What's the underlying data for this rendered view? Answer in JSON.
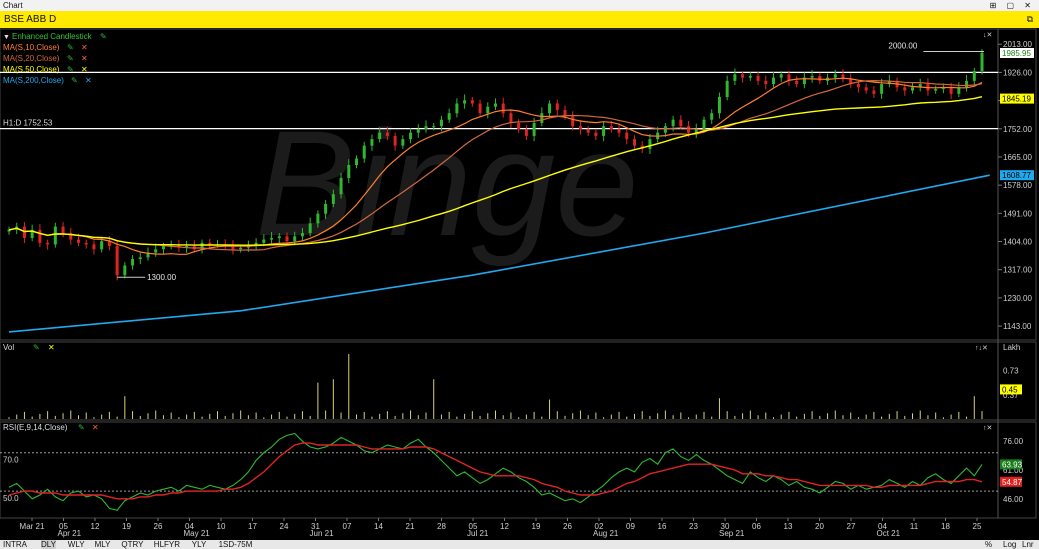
{
  "window": {
    "title": "Chart",
    "controls": "⊞ ▢ ✕"
  },
  "symbol_bar": {
    "symbol": "BSE ABB D",
    "icon": "restore-icon"
  },
  "price_panel": {
    "legend": [
      {
        "label": "Enhanced Candlestick",
        "color": "#34c134"
      },
      {
        "label": "MA(S,10,Close)",
        "color": "#ff7f2a"
      },
      {
        "label": "MA(S,20,Close)",
        "color": "#d2693c"
      },
      {
        "label": "MA(S,50,Close)",
        "color": "#ffff00"
      },
      {
        "label": "MA(S,200,Close)",
        "color": "#1fa9ee"
      }
    ],
    "h1_label": "H1:D 1752.53",
    "annotation_high": "2000.00",
    "annotation_low": "1300.00",
    "y_ticks": [
      "2013.00",
      "1926.00",
      "1839.00",
      "1752.00",
      "1665.00",
      "1578.00",
      "1491.00",
      "1404.00",
      "1317.00",
      "1230.00",
      "1143.00"
    ],
    "badges": [
      {
        "text": "1985.95",
        "value": 1985.95,
        "bg": "#ffffff",
        "fg": "#1a7d1a"
      },
      {
        "text": "1845.19",
        "value": 1845.19,
        "bg": "#ffff00",
        "fg": "#000000"
      },
      {
        "text": "1608.77",
        "value": 1608.77,
        "bg": "#1fa9ee",
        "fg": "#000000"
      }
    ]
  },
  "volume_panel": {
    "label": "Vol",
    "unit": "Lakh",
    "y_ticks": [
      "0.73",
      "0.37"
    ],
    "badge": {
      "text": "0.45",
      "bg": "#ffff00",
      "fg": "#000000"
    }
  },
  "rsi_panel": {
    "label": "RSI(E,9,14,Close)",
    "left_ticks": [
      "70.0",
      "50.0"
    ],
    "y_ticks": [
      "76.00",
      "61.00",
      "46.00"
    ],
    "badges": [
      {
        "text": "63.93",
        "value": 63.93,
        "bg": "#1a7d1a",
        "fg": "#ffffff"
      },
      {
        "text": "54.87",
        "value": 54.87,
        "bg": "#e22020",
        "fg": "#ffffff"
      }
    ]
  },
  "x_axis": {
    "labels": [
      "Mar 21",
      "05",
      "12",
      "19",
      "26",
      "04",
      "10",
      "17",
      "24",
      "31",
      "07",
      "14",
      "21",
      "28",
      "05",
      "12",
      "19",
      "26",
      "02",
      "09",
      "16",
      "23",
      "30",
      "06",
      "13",
      "20",
      "27",
      "04",
      "11",
      "18",
      "25"
    ],
    "month_labels": [
      "Apr 21",
      "May 21",
      "Jun 21",
      "Jul 21",
      "Aug 21",
      "Sep 21",
      "Oct 21"
    ]
  },
  "watermark": "Binge",
  "bottom_tabs": [
    "INTRA",
    "DLY",
    "WLY",
    "MLY",
    "QTRY",
    "HLFYR",
    "YLY",
    "1SD-75M"
  ],
  "active_tab": "DLY",
  "bottom_right": [
    "%",
    "Log",
    "Lnr"
  ],
  "chart_data": {
    "type": "candlestick",
    "title": "BSE ABB D",
    "period": "Daily",
    "x_range": [
      "Mar 21",
      "Oct 21"
    ],
    "ylim": [
      1100,
      2060
    ],
    "y_ticks": [
      2013,
      1926,
      1839,
      1752,
      1665,
      1578,
      1491,
      1404,
      1317,
      1230,
      1143
    ],
    "horizontal_lines": [
      1926,
      1752.53
    ],
    "key_points": {
      "high_annotation": 2000,
      "low_annotation": 1300,
      "last_close": 1985.95
    },
    "close_approx": [
      1440,
      1450,
      1415,
      1440,
      1400,
      1395,
      1450,
      1430,
      1410,
      1400,
      1395,
      1380,
      1405,
      1390,
      1300,
      1330,
      1350,
      1355,
      1370,
      1380,
      1390,
      1395,
      1385,
      1390,
      1380,
      1400,
      1395,
      1395,
      1390,
      1380,
      1385,
      1395,
      1400,
      1410,
      1415,
      1420,
      1405,
      1420,
      1430,
      1460,
      1490,
      1520,
      1550,
      1600,
      1640,
      1660,
      1700,
      1720,
      1740,
      1730,
      1700,
      1720,
      1740,
      1750,
      1760,
      1760,
      1780,
      1800,
      1830,
      1840,
      1830,
      1800,
      1820,
      1830,
      1800,
      1770,
      1750,
      1730,
      1770,
      1800,
      1830,
      1810,
      1790,
      1760,
      1750,
      1740,
      1730,
      1760,
      1750,
      1740,
      1720,
      1700,
      1690,
      1720,
      1740,
      1760,
      1780,
      1760,
      1740,
      1750,
      1780,
      1800,
      1850,
      1900,
      1920,
      1910,
      1915,
      1900,
      1890,
      1910,
      1920,
      1900,
      1890,
      1910,
      1915,
      1900,
      1910,
      1920,
      1905,
      1890,
      1880,
      1870,
      1860,
      1890,
      1900,
      1880,
      1870,
      1880,
      1890,
      1870,
      1875,
      1880,
      1860,
      1880,
      1900,
      1930,
      1985.95
    ],
    "series": [
      {
        "name": "MA(S,10,Close)",
        "color": "#ff7f2a"
      },
      {
        "name": "MA(S,20,Close)",
        "color": "#d2693c"
      },
      {
        "name": "MA(S,50,Close)",
        "color": "#ffff00",
        "last": 1845.19
      },
      {
        "name": "MA(S,200,Close)",
        "color": "#1fa9ee",
        "points": [
          [
            0,
            1125
          ],
          [
            30,
            1190
          ],
          [
            60,
            1300
          ],
          [
            90,
            1430
          ],
          [
            127,
            1608.77
          ]
        ]
      }
    ],
    "volume": {
      "unit": "Lakh",
      "ticks": [
        0.73,
        0.37
      ],
      "last": 0.45,
      "spikes": [
        [
          15,
          0.35
        ],
        [
          40,
          0.55
        ],
        [
          42,
          0.6
        ],
        [
          44,
          0.97
        ],
        [
          55,
          0.6
        ],
        [
          70,
          0.3
        ],
        [
          92,
          0.32
        ],
        [
          125,
          0.35
        ],
        [
          127,
          0.45
        ]
      ]
    },
    "rsi": {
      "levels": [
        70,
        50
      ],
      "ticks": [
        76,
        61,
        46
      ],
      "green_last": 63.93,
      "red_last": 54.87,
      "green": [
        52,
        54,
        50,
        46,
        48,
        51,
        47,
        45,
        49,
        50,
        47,
        48,
        46,
        41,
        40,
        45,
        47,
        49,
        48,
        50,
        51,
        52,
        50,
        53,
        52,
        51,
        53,
        52,
        51,
        53,
        56,
        60,
        66,
        70,
        73,
        77,
        79,
        80,
        76,
        73,
        72,
        73,
        75,
        78,
        76,
        74,
        71,
        70,
        72,
        74,
        73,
        72,
        75,
        77,
        73,
        70,
        66,
        62,
        58,
        60,
        57,
        54,
        56,
        59,
        62,
        60,
        57,
        55,
        52,
        48,
        49,
        47,
        45,
        46,
        44,
        47,
        50,
        53,
        57,
        60,
        62,
        60,
        65,
        67,
        64,
        70,
        72,
        68,
        66,
        69,
        66,
        64,
        61,
        58,
        56,
        54,
        60,
        57,
        55,
        58,
        56,
        53,
        55,
        52,
        51,
        49,
        52,
        55,
        54,
        51,
        53,
        51,
        52,
        53,
        56,
        54,
        52,
        55,
        53,
        57,
        59,
        56,
        54,
        58,
        62,
        58,
        63.93
      ],
      "red": [
        48,
        49,
        50,
        50,
        49,
        49,
        49,
        48,
        48,
        48,
        48,
        48,
        48,
        47,
        46,
        46,
        46,
        47,
        47,
        48,
        48,
        49,
        49,
        50,
        50,
        50,
        50,
        50,
        51,
        51,
        52,
        54,
        57,
        60,
        64,
        68,
        71,
        74,
        75,
        75,
        74,
        74,
        74,
        74,
        74,
        74,
        73,
        72,
        72,
        72,
        72,
        72,
        73,
        73,
        73,
        72,
        70,
        68,
        66,
        64,
        62,
        60,
        59,
        58,
        58,
        58,
        58,
        57,
        56,
        54,
        53,
        52,
        50,
        49,
        48,
        48,
        48,
        49,
        50,
        52,
        54,
        55,
        57,
        59,
        60,
        61,
        62,
        63,
        64,
        64,
        64,
        64,
        63,
        62,
        61,
        59,
        59,
        59,
        58,
        58,
        57,
        56,
        56,
        55,
        54,
        53,
        53,
        53,
        53,
        53,
        53,
        53,
        52,
        52,
        53,
        53,
        53,
        53,
        53,
        54,
        55,
        55,
        55,
        55,
        56,
        56,
        54.87
      ]
    }
  }
}
